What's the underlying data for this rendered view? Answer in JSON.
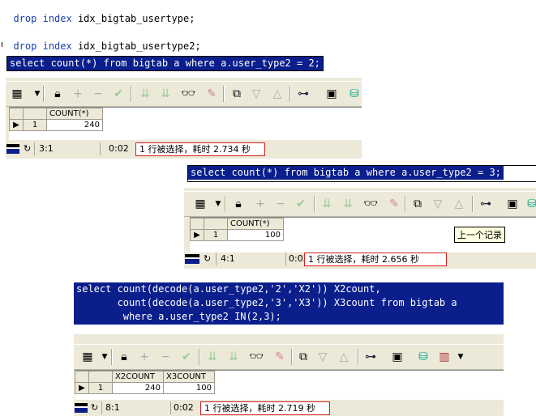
{
  "code_lines": {
    "line1_kw1": "drop",
    "line1_kw2": "index",
    "line1_name": "idx_bigtab_usertype;",
    "line2_kw1": "drop",
    "line2_kw2": "index",
    "line2_name": "idx_bigtab_usertype2;"
  },
  "panel1": {
    "sql": "select count(*) from bigtab a where a.user_type2 = 2;",
    "grid_header": [
      "",
      "",
      "COUNT(*)"
    ],
    "row_num": "1",
    "row_value": "240",
    "status_pos": "3:1",
    "status_time": "0:02",
    "status_msg": "1 行被选择，耗时 2.734 秒"
  },
  "panel2": {
    "sql": "select count(*) from bigtab a where a.user_type2 = 3;",
    "grid_header": [
      "",
      "",
      "COUNT(*)"
    ],
    "row_num": "1",
    "row_value": "100",
    "status_pos": "4:1",
    "status_time": "0:02",
    "status_msg": "1 行被选择，耗时 2.656 秒",
    "tooltip": "上一个记录"
  },
  "panel3": {
    "sql_line1": "select count(decode(a.user_type2,'2','X2')) X2count,",
    "sql_line2": "       count(decode(a.user_type2,'3','X3')) X3count from bigtab a",
    "sql_line3": "        where a.user_type2 IN(2,3);",
    "col1": "X2COUNT",
    "col2": "X3COUNT",
    "row_num": "1",
    "val1": "240",
    "val2": "100",
    "status_pos": "8:1",
    "status_time": "0:02",
    "status_msg": "1 行被选择，耗时 2.719 秒"
  },
  "toolbar_icons": [
    "grid-icon",
    "lock-icon",
    "plus-icon",
    "minus-icon",
    "check-icon",
    "down-double-icon",
    "down-double-icon",
    "binoculars-icon",
    "eraser-icon",
    "stack-icon",
    "triangle-down-icon",
    "triangle-up-icon",
    "tree-icon",
    "save-icon",
    "database-icon",
    "chart-icon"
  ],
  "colors": {
    "selection": "#0a1e8c",
    "keyword": "#1a3fb0",
    "panel": "#ece9d8",
    "status_border": "#d42020"
  }
}
